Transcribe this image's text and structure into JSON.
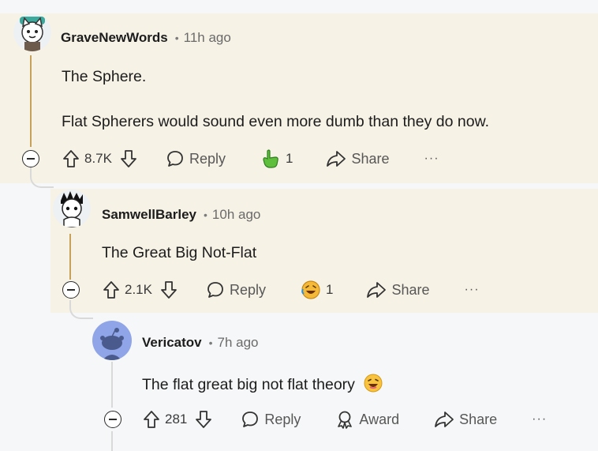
{
  "comments": [
    {
      "author": "GraveNewWords",
      "time": "11h ago",
      "body_lines": [
        "The Sphere.",
        "Flat Spherers would sound even more dumb than they do now."
      ],
      "upvotes": "8.7K",
      "reply_label": "Reply",
      "award_count": "1",
      "share_label": "Share",
      "more": "···"
    },
    {
      "author": "SamwellBarley",
      "time": "10h ago",
      "body_lines": [
        "The Great Big Not-Flat"
      ],
      "upvotes": "2.1K",
      "reply_label": "Reply",
      "award_count": "1",
      "share_label": "Share",
      "more": "···"
    },
    {
      "author": "Vericatov",
      "time": "7h ago",
      "body_lines": [
        "The flat great big not flat theory"
      ],
      "upvotes": "281",
      "reply_label": "Reply",
      "award_label": "Award",
      "share_label": "Share",
      "more": "···"
    }
  ],
  "colors": {
    "highlight": "#f6f2e6",
    "thread_gold": "#c5a15a",
    "thread_gray": "#d9d9d9",
    "award_green": "#4caf32",
    "snoo_avatar": "#8fa5e8"
  },
  "icons": [
    "upvote-icon",
    "downvote-icon",
    "reply-icon",
    "award-icon",
    "share-icon",
    "collapse-icon",
    "laugh-emoji-icon"
  ]
}
